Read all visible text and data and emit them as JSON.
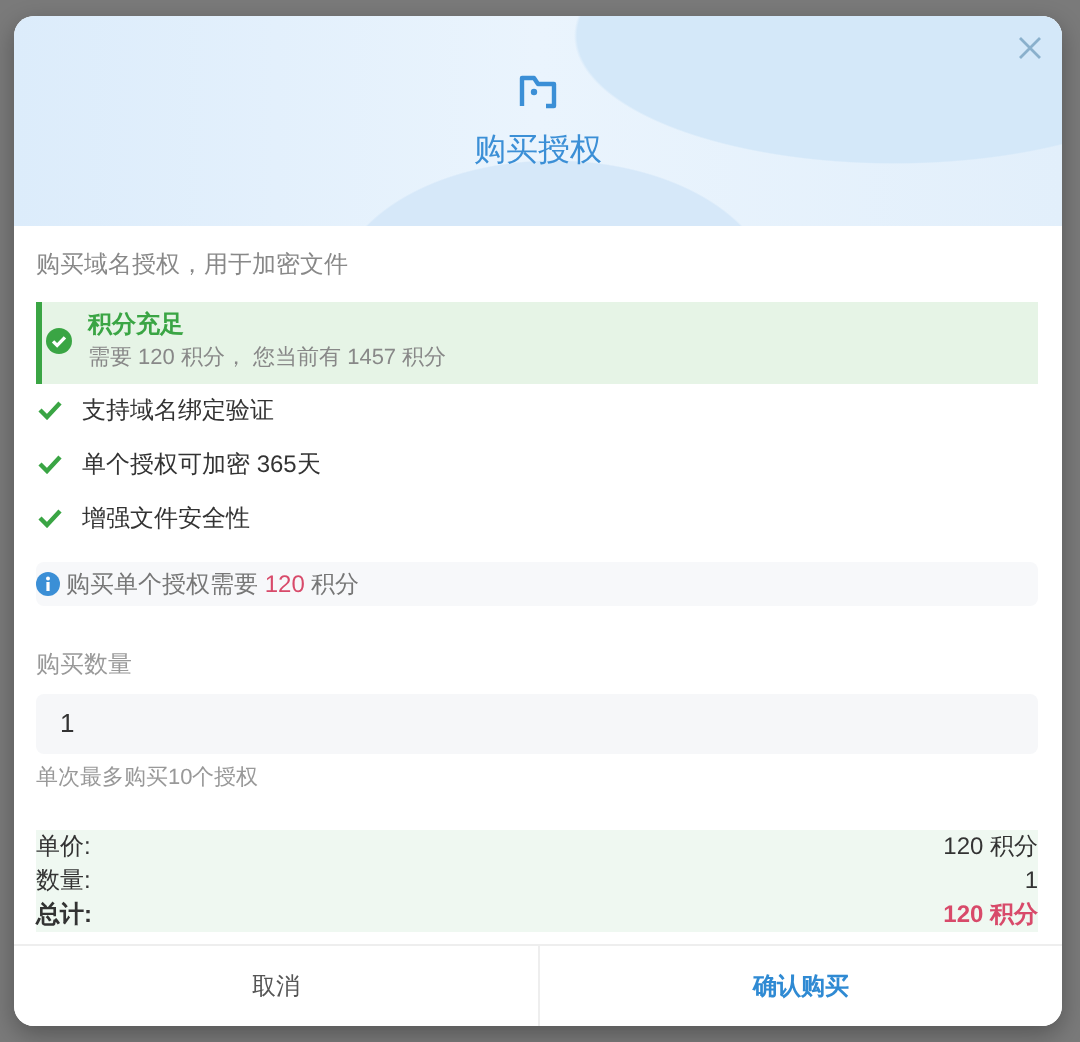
{
  "dialog": {
    "title": "购买授权",
    "subtitle": "购买域名授权，用于加密文件"
  },
  "status": {
    "kind": "success",
    "title": "积分充足",
    "detail": "需要 120 积分， 您当前有 1457 积分"
  },
  "features": [
    "支持域名绑定验证",
    "单个授权可加密 365天",
    "增强文件安全性"
  ],
  "note": {
    "before": "购买单个授权需要 ",
    "highlight": "120",
    "after": " 积分"
  },
  "quantity": {
    "label": "购买数量",
    "value": "1",
    "hint": "单次最多购买10个授权"
  },
  "summary": [
    {
      "label": "单价:",
      "value": "120 积分",
      "kind": "normal"
    },
    {
      "label": "数量:",
      "value": "1",
      "kind": "normal"
    },
    {
      "label": "总计:",
      "value": "120 积分",
      "kind": "total"
    }
  ],
  "buttons": [
    {
      "label": "取消",
      "kind": "cancel"
    },
    {
      "label": "确认购买",
      "kind": "primary"
    }
  ]
}
